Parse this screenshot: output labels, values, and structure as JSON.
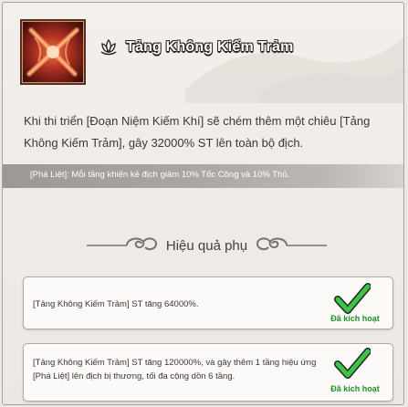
{
  "skill": {
    "title": "Tảng Không Kiếm Trảm",
    "description": "Khi thi triển [Đoạn Niệm Kiếm Khí] sẽ chém thêm một chiêu [Tảng Không Kiếm Trảm], gây 32000% ST lên toàn bộ địch.",
    "note": "[Phá Liệt]: Mỗi tầng khiến kẻ địch giảm 10% Tốc Công và 10% Thủ."
  },
  "section": {
    "title": "Hiệu quả phụ"
  },
  "effects": [
    {
      "text": "[Tảng Không Kiếm Trảm] ST tăng 64000%.",
      "status": "Đã kích hoạt"
    },
    {
      "text": "[Tảng Không Kiếm Trảm] ST tăng 120000%, và gây thêm 1 tầng hiệu ứng [Phá Liệt] lên địch bị thương, tối đa cộng dồn 6 tầng.",
      "status": "Đã kích hoạt"
    }
  ],
  "icons": {
    "skill": "crossed-blades-skill-icon",
    "title": "lotus-icon",
    "status": "checkmark-icon"
  },
  "colors": {
    "accent_green": "#1f8f2a",
    "title_outline": "#2b2421"
  }
}
